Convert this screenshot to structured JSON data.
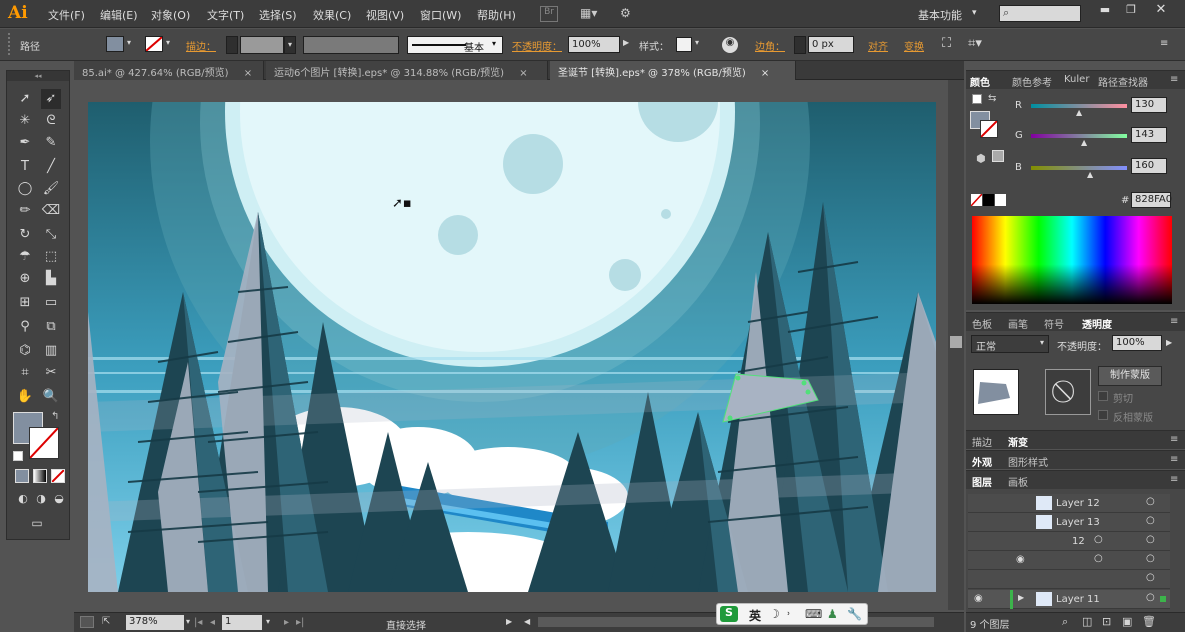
{
  "app": {
    "logo": "Ai",
    "workspace": "基本功能"
  },
  "menu": [
    "文件(F)",
    "编辑(E)",
    "对象(O)",
    "文字(T)",
    "选择(S)",
    "效果(C)",
    "视图(V)",
    "窗口(W)",
    "帮助(H)"
  ],
  "control": {
    "selection_label": "路径",
    "stroke_label": "描边：",
    "brush_label": "基本",
    "opacity_label": "不透明度：",
    "opacity_value": "100%",
    "style_label": "样式：",
    "corner_label": "边角：",
    "corner_value": "0 px",
    "align_label": "对齐",
    "transform_label": "变换"
  },
  "tabs": [
    "85.ai* @ 427.64% (RGB/预览)",
    "运动6个图片 [转换].eps* @ 314.88% (RGB/预览)",
    "圣诞节 [转换].eps* @ 378% (RGB/预览)"
  ],
  "color_panel": {
    "tabs": [
      "颜色",
      "颜色参考",
      "Kuler",
      "路径查找器"
    ],
    "r_label": "R",
    "g_label": "G",
    "b_label": "B",
    "r": "130",
    "g": "143",
    "b": "160",
    "hex_label": "#",
    "hex": "828FA0",
    "fill_color": "#828FA0"
  },
  "transparency_panel": {
    "tabs": [
      "色板",
      "画笔",
      "符号",
      "透明度"
    ],
    "blend_mode": "正常",
    "opacity_label": "不透明度：",
    "opacity": "100%",
    "make_mask": "制作蒙版",
    "clip": "剪切",
    "invert": "反相蒙版"
  },
  "stroke_panel": {
    "tabs": [
      "描边",
      "渐变"
    ]
  },
  "appearance_panel": {
    "tabs": [
      "外观",
      "图形样式"
    ]
  },
  "layers_panel": {
    "tabs": [
      "图层",
      "画板"
    ],
    "rows": [
      "Layer 12",
      "Layer 13",
      "12",
      "",
      "Layer 11"
    ],
    "count": "9 个图层"
  },
  "status": {
    "zoom": "378%",
    "artboard": "1",
    "tool": "直接选择"
  },
  "ime": {
    "logo": "S",
    "lang": "英"
  }
}
